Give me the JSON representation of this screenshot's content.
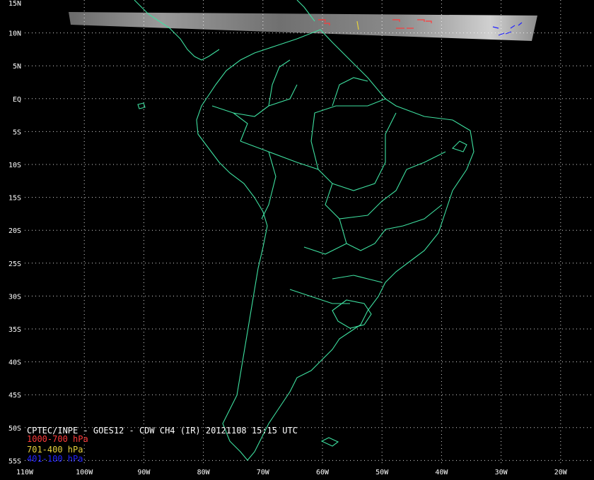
{
  "title": "CPTEC/INPE - GOES12 - CDW CH4 (IR) 20121108 15:15 UTC",
  "legend": [
    {
      "label": "1000-700 hPa",
      "color": "#ff3b3b"
    },
    {
      "label": "701-400 hPa",
      "color": "#e6d23c"
    },
    {
      "label": "401-100 hPa",
      "color": "#2323ff"
    }
  ],
  "lat_labels": [
    "15N",
    "10N",
    "5N",
    "EQ",
    "5S",
    "10S",
    "15S",
    "20S",
    "25S",
    "30S",
    "35S",
    "40S",
    "45S",
    "50S",
    "55S"
  ],
  "lon_labels": [
    "110W",
    "100W",
    "90W",
    "80W",
    "70W",
    "60W",
    "50W",
    "40W",
    "30W",
    "20W"
  ],
  "colors": {
    "background": "#000000",
    "coast": "#3ee0a0",
    "grid": "#ffffff",
    "text": "#ffffff"
  }
}
